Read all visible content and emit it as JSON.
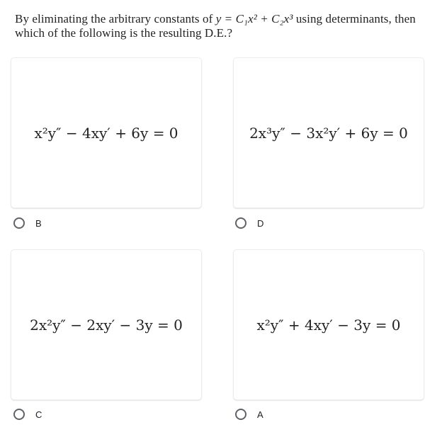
{
  "question": {
    "prefix": "By eliminating the arbitrary constants of ",
    "equation": "y = C₁x² + C₂x³",
    "suffix": " using determinants, then which of the following is the resulting D.E.?"
  },
  "options": [
    {
      "equation": "x²y″ − 4xy′ + 6y = 0",
      "label": "B",
      "selected": false
    },
    {
      "equation": "2x³y″ − 3x²y′ + 6y = 0",
      "label": "D",
      "selected": false
    },
    {
      "equation": "2x²y″ − 2xy′ − 3y = 0",
      "label": "C",
      "selected": false
    },
    {
      "equation": "x²y″ + 4xy′ − 3y = 0",
      "label": "A",
      "selected": false
    }
  ]
}
